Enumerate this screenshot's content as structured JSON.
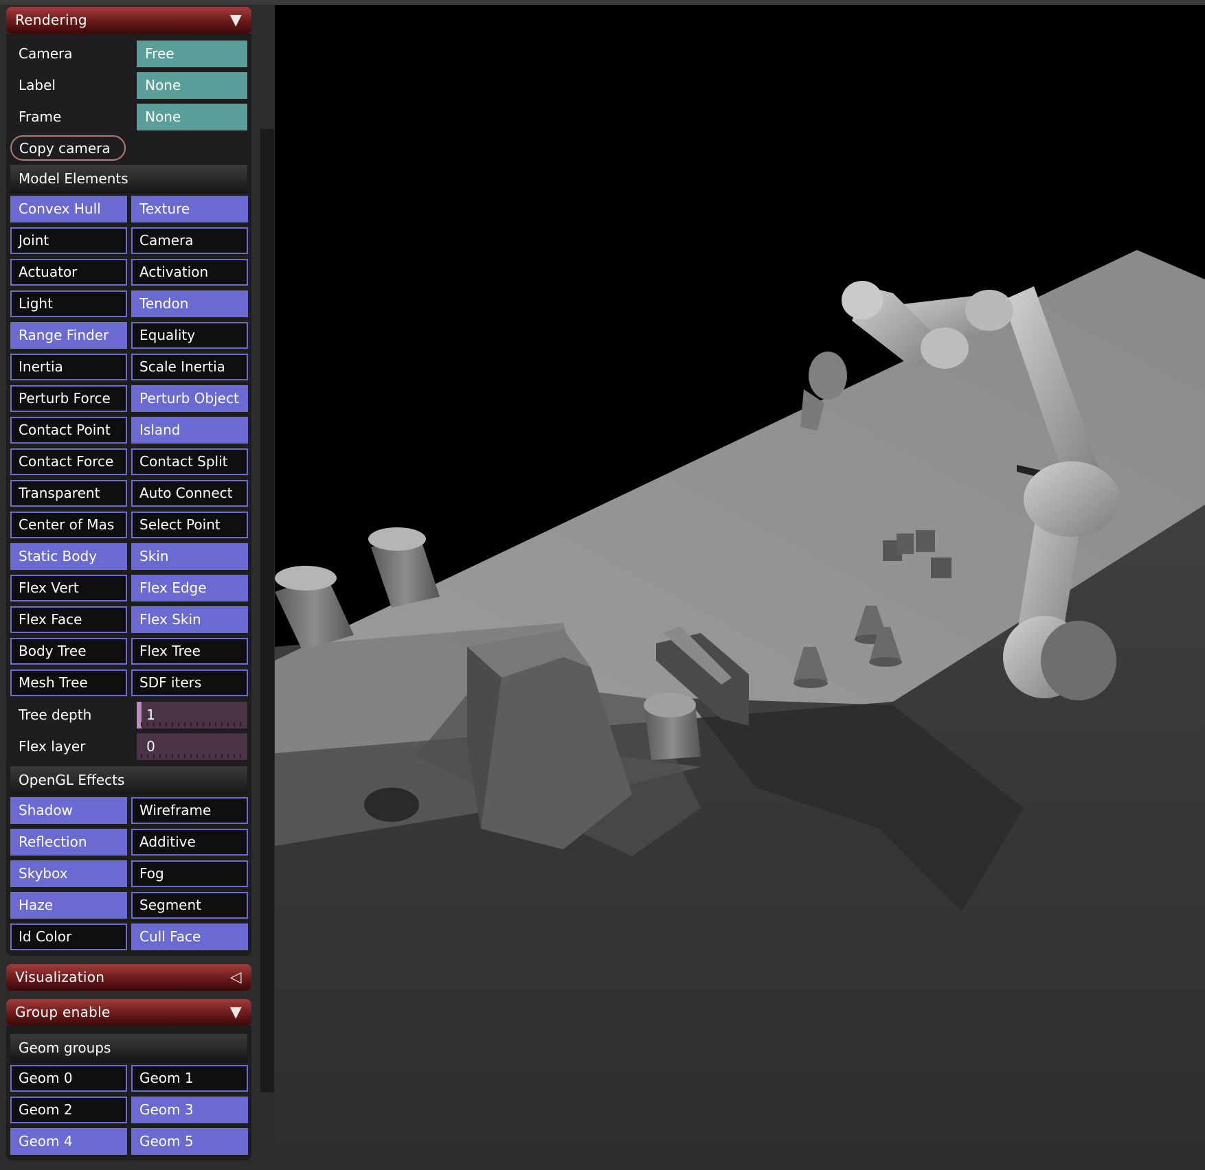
{
  "panel": {
    "rendering": {
      "title": "Rendering",
      "collapse_icon": "triangle-down-icon",
      "rows": [
        {
          "label": "Camera",
          "value": "Free"
        },
        {
          "label": "Label",
          "value": "None"
        },
        {
          "label": "Frame",
          "value": "None"
        }
      ],
      "copy_camera": "Copy camera",
      "model_elements": {
        "title": "Model Elements",
        "toggles": [
          {
            "label": "Convex Hull",
            "on": true
          },
          {
            "label": "Texture",
            "on": true
          },
          {
            "label": "Joint",
            "on": false
          },
          {
            "label": "Camera",
            "on": false
          },
          {
            "label": "Actuator",
            "on": false
          },
          {
            "label": "Activation",
            "on": false
          },
          {
            "label": "Light",
            "on": false
          },
          {
            "label": "Tendon",
            "on": true
          },
          {
            "label": "Range Finder",
            "on": true
          },
          {
            "label": "Equality",
            "on": false
          },
          {
            "label": "Inertia",
            "on": false
          },
          {
            "label": "Scale Inertia",
            "on": false
          },
          {
            "label": "Perturb Force",
            "on": false
          },
          {
            "label": "Perturb Object",
            "on": true
          },
          {
            "label": "Contact Point",
            "on": false
          },
          {
            "label": "Island",
            "on": true
          },
          {
            "label": "Contact Force",
            "on": false
          },
          {
            "label": "Contact Split",
            "on": false
          },
          {
            "label": "Transparent",
            "on": false
          },
          {
            "label": "Auto Connect",
            "on": false
          },
          {
            "label": "Center of Mas",
            "on": false
          },
          {
            "label": "Select Point",
            "on": false
          },
          {
            "label": "Static Body",
            "on": true
          },
          {
            "label": "Skin",
            "on": true
          },
          {
            "label": "Flex Vert",
            "on": false
          },
          {
            "label": "Flex Edge",
            "on": true
          },
          {
            "label": "Flex Face",
            "on": false
          },
          {
            "label": "Flex Skin",
            "on": true
          },
          {
            "label": "Body Tree",
            "on": false
          },
          {
            "label": "Flex Tree",
            "on": false
          },
          {
            "label": "Mesh Tree",
            "on": false
          },
          {
            "label": "SDF iters",
            "on": false
          }
        ],
        "sliders": [
          {
            "label": "Tree depth",
            "value": "1",
            "level": 0.0
          },
          {
            "label": "Flex layer",
            "value": "0",
            "level": 0.0
          }
        ]
      },
      "opengl_effects": {
        "title": "OpenGL Effects",
        "toggles": [
          {
            "label": "Shadow",
            "on": true
          },
          {
            "label": "Wireframe",
            "on": false
          },
          {
            "label": "Reflection",
            "on": true
          },
          {
            "label": "Additive",
            "on": false
          },
          {
            "label": "Skybox",
            "on": true
          },
          {
            "label": "Fog",
            "on": false
          },
          {
            "label": "Haze",
            "on": true
          },
          {
            "label": "Segment",
            "on": false
          },
          {
            "label": "Id Color",
            "on": false
          },
          {
            "label": "Cull Face",
            "on": true
          }
        ]
      }
    },
    "visualization": {
      "title": "Visualization",
      "collapse_icon": "triangle-left-icon"
    },
    "group_enable": {
      "title": "Group enable",
      "collapse_icon": "triangle-down-icon",
      "geom_groups": {
        "title": "Geom groups",
        "toggles": [
          {
            "label": "Geom 0",
            "on": false
          },
          {
            "label": "Geom 1",
            "on": false
          },
          {
            "label": "Geom 2",
            "on": false
          },
          {
            "label": "Geom 3",
            "on": true
          },
          {
            "label": "Geom 4",
            "on": true
          },
          {
            "label": "Geom 5",
            "on": true
          }
        ]
      }
    }
  },
  "colors": {
    "header_red": "#8f2a2a",
    "toggle_on": "#6a6ad2",
    "toggle_border": "#6a6adc",
    "select_teal": "#5a9f9a",
    "slider_bg": "#4a3344",
    "slider_knob": "#c28ac2",
    "copy_button_border": "#b27a7a"
  }
}
